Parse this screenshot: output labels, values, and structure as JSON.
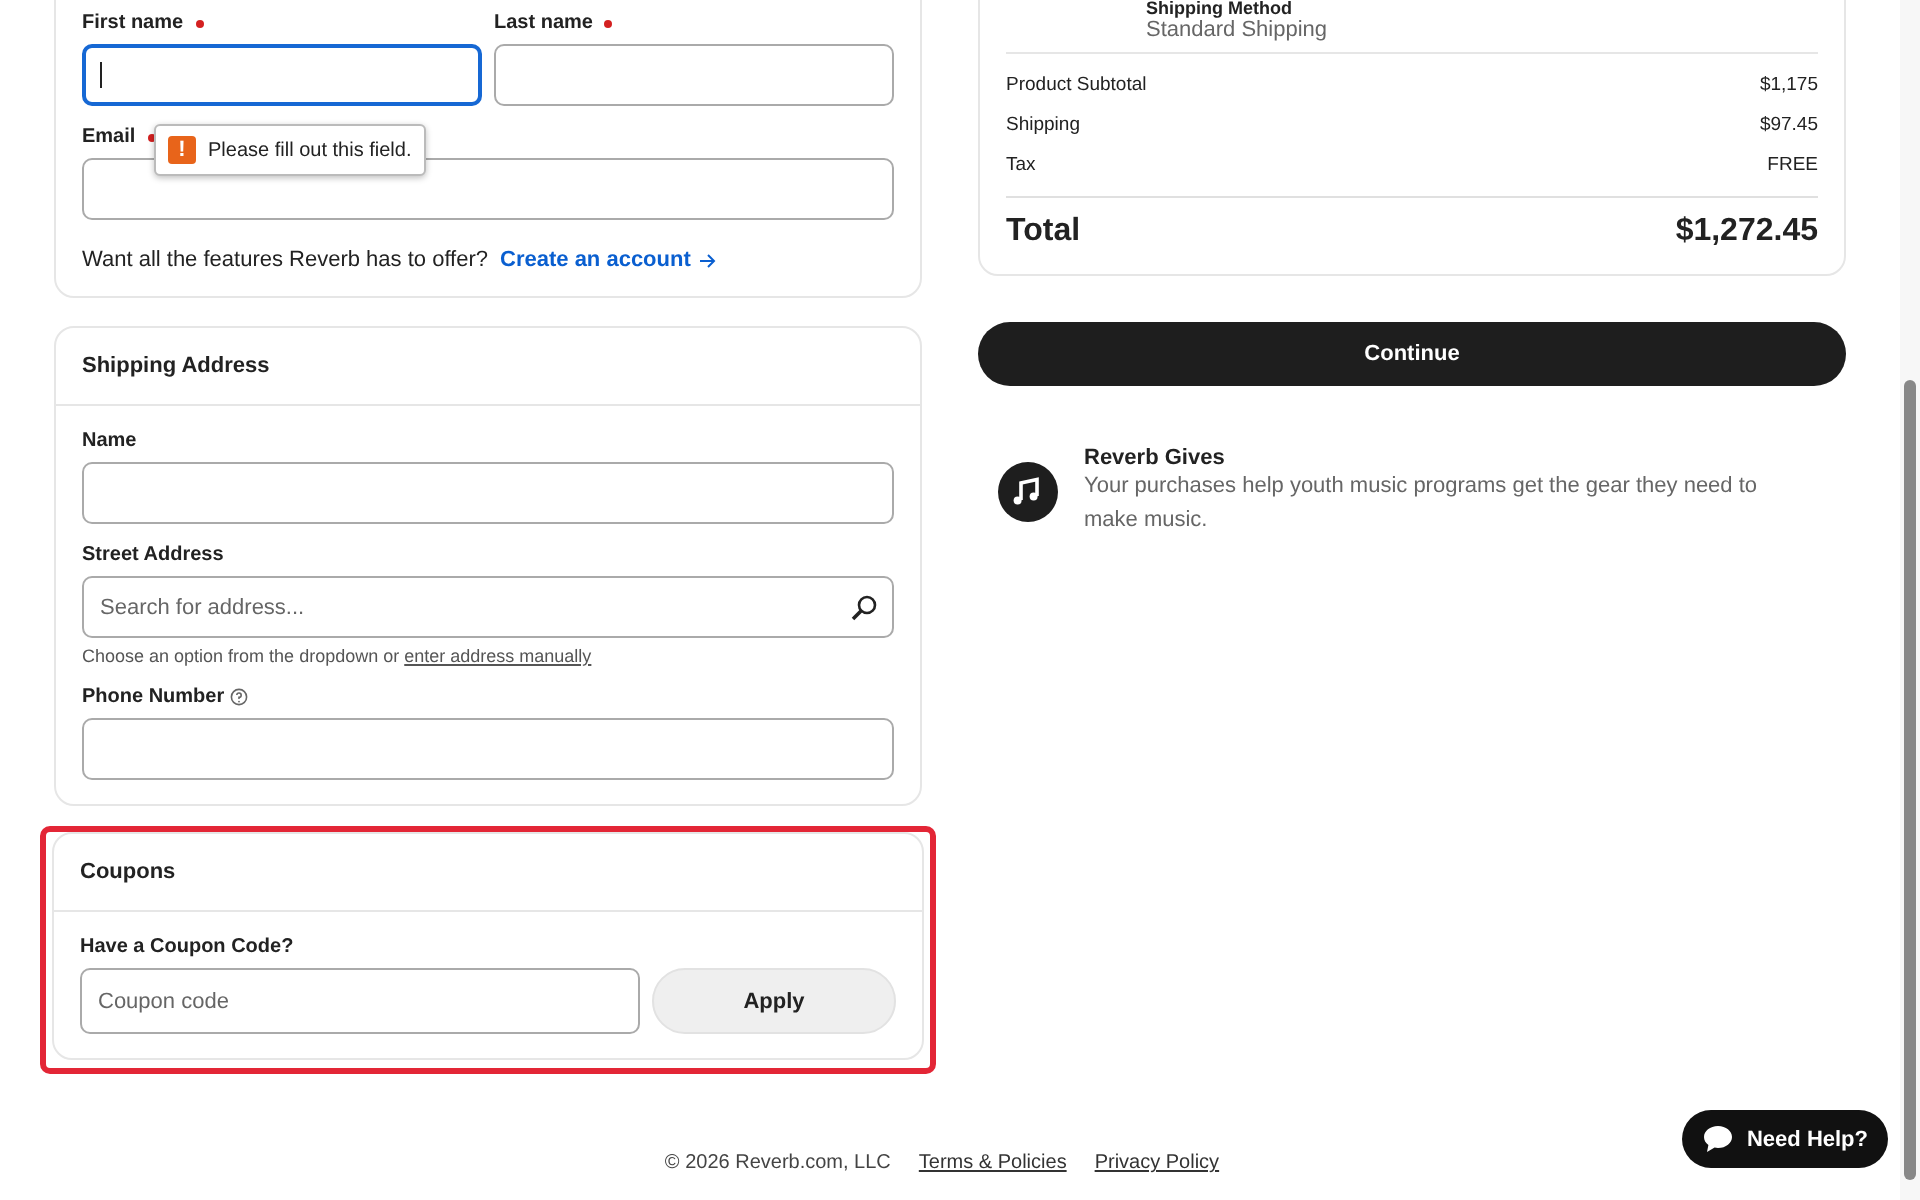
{
  "contact": {
    "fields": [
      {
        "label": "First name",
        "required": true,
        "focused": true
      },
      {
        "label": "Last name",
        "required": true,
        "focused": false
      }
    ],
    "email": {
      "label": "Email",
      "required": true
    },
    "validation_icon": "!",
    "validation_tooltip": "Please fill out this field.",
    "account_prompt": "Want all the features Reverb has to offer?",
    "account_link": "Create an account"
  },
  "shipping_address": {
    "title": "Shipping Address",
    "name_label": "Name",
    "street_label": "Street Address",
    "street_placeholder": "Search for address...",
    "hint": "Choose an option from the dropdown or",
    "hint_link": "enter address manually",
    "phone_label": "Phone Number"
  },
  "coupons": {
    "title": "Coupons",
    "label": "Have a Coupon Code?",
    "placeholder": "Coupon code",
    "button": "Apply",
    "highlighted": true
  },
  "summary": {
    "shipping_method_label": "Shipping Method",
    "shipping_method": "Standard Shipping",
    "lines": [
      {
        "label": "Product Subtotal",
        "value": "$1,175"
      },
      {
        "label": "Shipping",
        "value": "$97.45"
      },
      {
        "label": "Tax",
        "value": "FREE"
      }
    ],
    "total_label": "Total",
    "total_value": "$1,272.45"
  },
  "continue_button": "Continue",
  "gives": {
    "title": "Reverb Gives",
    "text": "Your purchases help youth music programs get the gear they need to make music."
  },
  "footer": {
    "copyright": "© 2026 Reverb.com, LLC",
    "links": [
      "Terms & Policies",
      "Privacy Policy"
    ]
  },
  "help_button": "Need Help?"
}
